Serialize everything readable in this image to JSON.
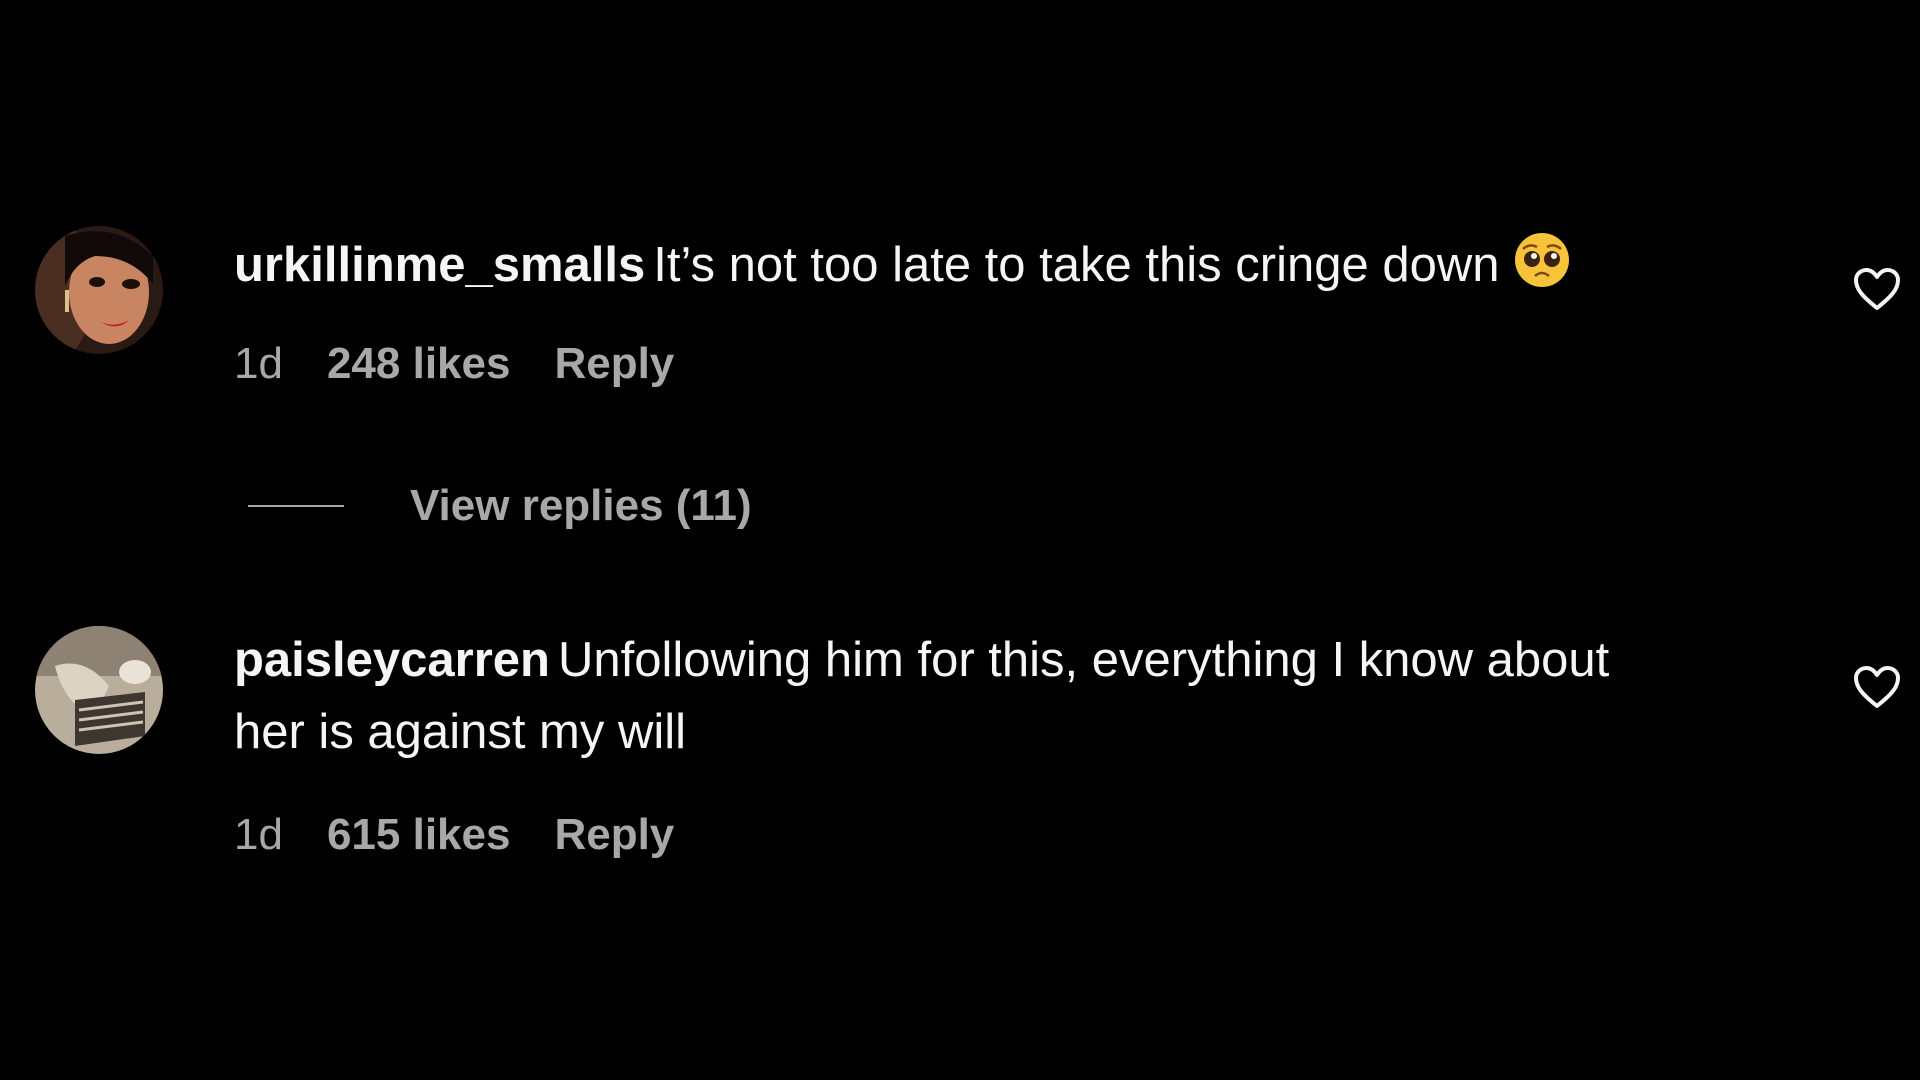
{
  "comments": [
    {
      "username": "urkillinme_smalls",
      "text": "It’s not too late to take this cringe down",
      "emoji": "pleading-face",
      "time": "1d",
      "likes": "248 likes",
      "reply_label": "Reply",
      "view_replies": "View replies (11)"
    },
    {
      "username": "paisleycarren",
      "text": "Unfollowing him for this, everything I know about her is against my will",
      "time": "1d",
      "likes": "615 likes",
      "reply_label": "Reply"
    }
  ],
  "colors": {
    "background": "#000000",
    "primary_text": "#f5f5f5",
    "secondary_text": "#a8a8a8"
  }
}
